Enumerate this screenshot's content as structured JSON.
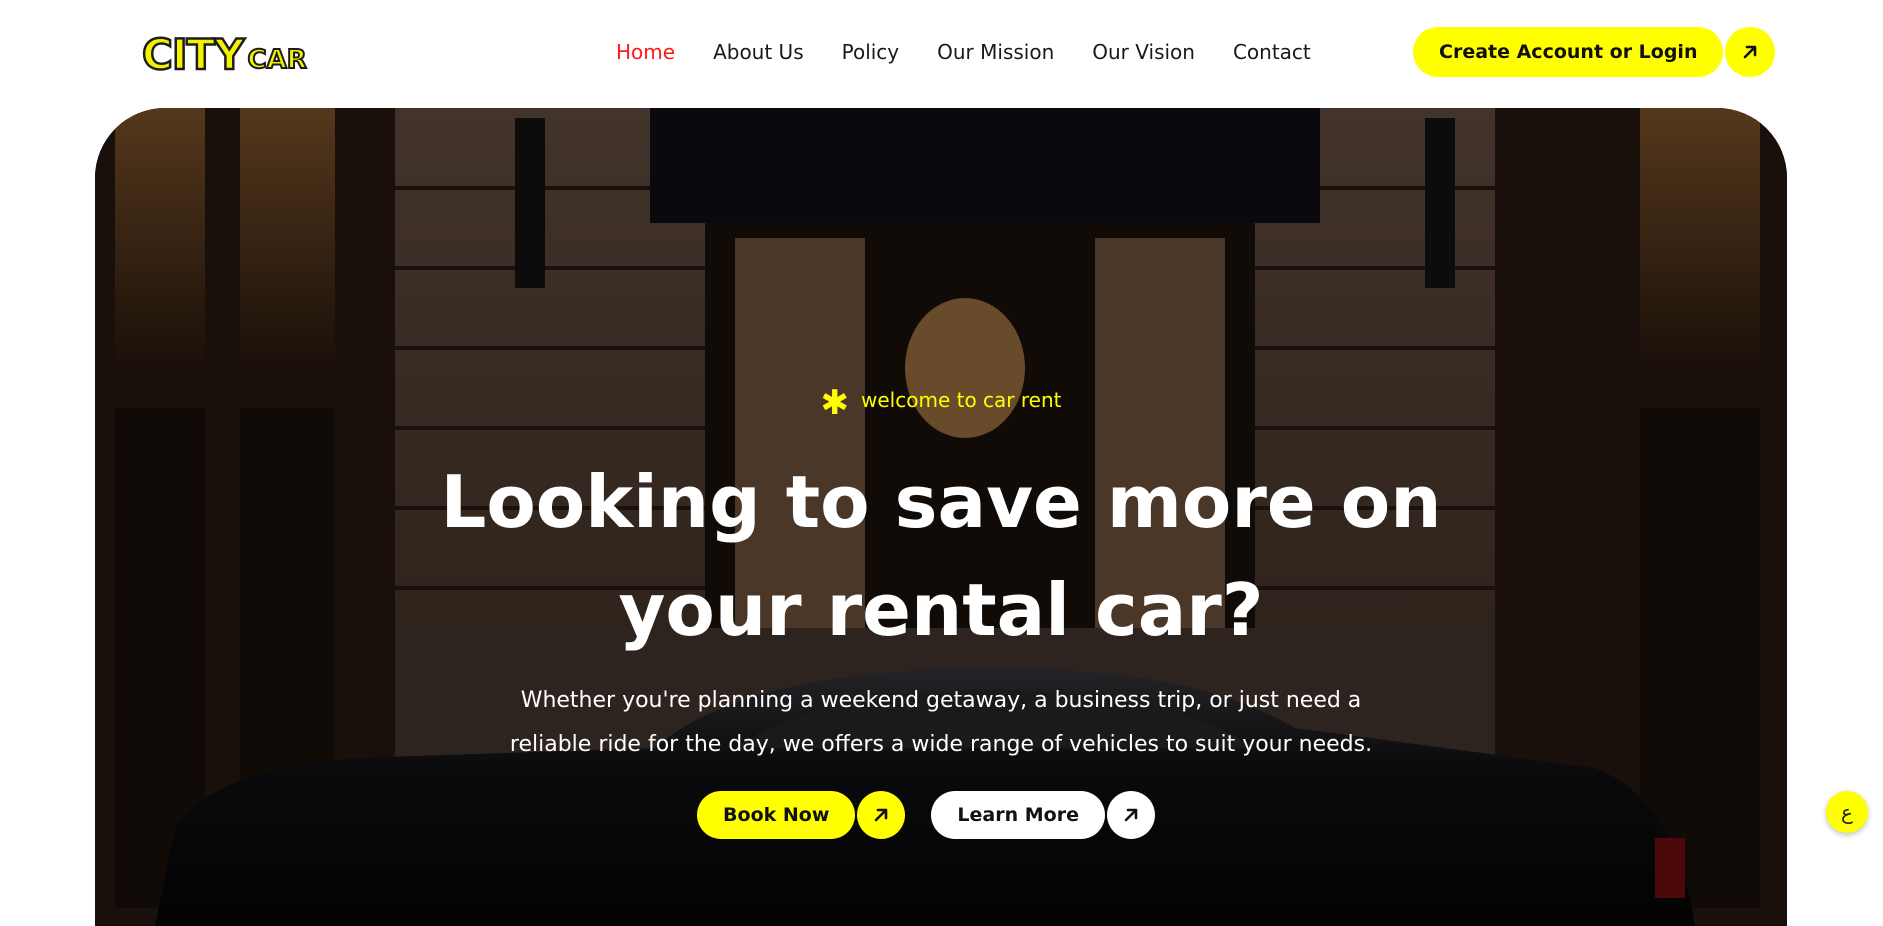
{
  "brand": {
    "logo_main": "CITY",
    "logo_sub": "CAR"
  },
  "nav": {
    "items": [
      {
        "label": "Home",
        "active": true
      },
      {
        "label": "About Us",
        "active": false
      },
      {
        "label": "Policy",
        "active": false
      },
      {
        "label": "Our Mission",
        "active": false
      },
      {
        "label": "Our Vision",
        "active": false
      },
      {
        "label": "Contact",
        "active": false
      }
    ]
  },
  "header_cta": {
    "label": "Create Account or Login",
    "icon": "arrow-up-right-icon"
  },
  "hero": {
    "eyebrow_icon": "asterisk-icon",
    "eyebrow": "welcome to car rent",
    "headline_line1": "Looking to save more on",
    "headline_line2": "your rental car?",
    "subtext_line1": "Whether you're planning a weekend getaway, a business trip, or just need a",
    "subtext_line2": "reliable ride for the day, we offers a wide range of vehicles to suit your needs.",
    "primary_button": {
      "label": "Book Now",
      "icon": "arrow-up-right-icon"
    },
    "secondary_button": {
      "label": "Learn More",
      "icon": "arrow-up-right-icon"
    }
  },
  "floating_button": {
    "label": "ع"
  },
  "colors": {
    "accent": "#ffff00",
    "active_nav": "#ff1a1a",
    "text_dark": "#1a1a1a"
  }
}
